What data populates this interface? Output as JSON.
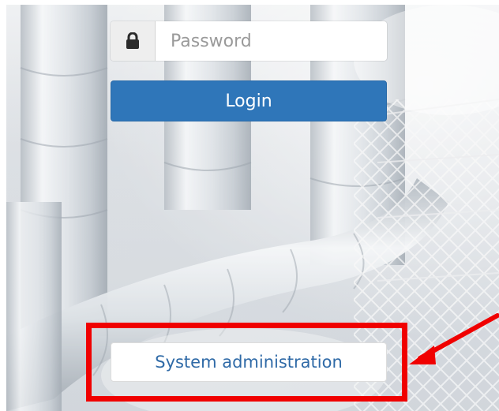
{
  "login_form": {
    "password_placeholder": "Password",
    "password_icon": "lock-icon",
    "login_label": "Login",
    "system_admin_label": "System administration"
  },
  "annotation": {
    "highlight_color": "#f00000",
    "highlight_target": "System administration"
  },
  "colors": {
    "primary": "#2f76b9",
    "link": "#2f6aa7"
  }
}
